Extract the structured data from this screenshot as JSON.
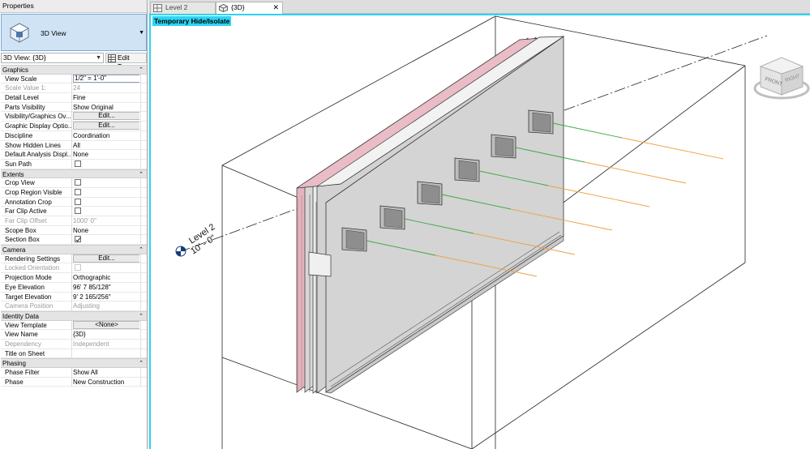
{
  "properties": {
    "title": "Properties",
    "type_name": "3D View",
    "instance_selector": "3D View: {3D}",
    "edit_type": "Edit Type",
    "sections": [
      {
        "name": "Graphics",
        "rows": [
          {
            "label": "View Scale",
            "value": "1/2\" = 1'-0\"",
            "kind": "input"
          },
          {
            "label": "Scale Value    1:",
            "value": "24",
            "kind": "text",
            "disabled": true
          },
          {
            "label": "Detail Level",
            "value": "Fine",
            "kind": "text"
          },
          {
            "label": "Parts Visibility",
            "value": "Show Original",
            "kind": "text"
          },
          {
            "label": "Visibility/Graphics Ov...",
            "value": "Edit...",
            "kind": "button"
          },
          {
            "label": "Graphic Display Optio...",
            "value": "Edit...",
            "kind": "button"
          },
          {
            "label": "Discipline",
            "value": "Coordination",
            "kind": "text"
          },
          {
            "label": "Show Hidden Lines",
            "value": "All",
            "kind": "text"
          },
          {
            "label": "Default Analysis Displ...",
            "value": "None",
            "kind": "text"
          },
          {
            "label": "Sun Path",
            "value": "",
            "kind": "check",
            "checked": false
          }
        ]
      },
      {
        "name": "Extents",
        "rows": [
          {
            "label": "Crop View",
            "value": "",
            "kind": "check",
            "checked": false
          },
          {
            "label": "Crop Region Visible",
            "value": "",
            "kind": "check",
            "checked": false
          },
          {
            "label": "Annotation Crop",
            "value": "",
            "kind": "check",
            "checked": false
          },
          {
            "label": "Far Clip Active",
            "value": "",
            "kind": "check",
            "checked": false
          },
          {
            "label": "Far Clip Offset",
            "value": "1000'  0\"",
            "kind": "text",
            "disabled": true
          },
          {
            "label": "Scope Box",
            "value": "None",
            "kind": "text"
          },
          {
            "label": "Section Box",
            "value": "",
            "kind": "check",
            "checked": true
          }
        ]
      },
      {
        "name": "Camera",
        "rows": [
          {
            "label": "Rendering Settings",
            "value": "Edit...",
            "kind": "button"
          },
          {
            "label": "Locked Orientation",
            "value": "",
            "kind": "check",
            "checked": false,
            "disabled": true
          },
          {
            "label": "Projection Mode",
            "value": "Orthographic",
            "kind": "text"
          },
          {
            "label": "Eye Elevation",
            "value": "96'  7 85/128\"",
            "kind": "text"
          },
          {
            "label": "Target Elevation",
            "value": "9'  2 165/256\"",
            "kind": "text"
          },
          {
            "label": "Camera Position",
            "value": "Adjusting",
            "kind": "text",
            "disabled": true
          }
        ]
      },
      {
        "name": "Identity Data",
        "rows": [
          {
            "label": "View Template",
            "value": "<None>",
            "kind": "button"
          },
          {
            "label": "View Name",
            "value": "{3D}",
            "kind": "text"
          },
          {
            "label": "Dependency",
            "value": "Independent",
            "kind": "text",
            "disabled": true
          },
          {
            "label": "Title on Sheet",
            "value": "",
            "kind": "text"
          }
        ]
      },
      {
        "name": "Phasing",
        "rows": [
          {
            "label": "Phase Filter",
            "value": "Show All",
            "kind": "text"
          },
          {
            "label": "Phase",
            "value": "New Construction",
            "kind": "text"
          }
        ]
      }
    ]
  },
  "tabs": [
    {
      "label": "Level 2",
      "icon": "floor-plan-icon",
      "active": false
    },
    {
      "label": "{3D}",
      "icon": "3d-view-icon",
      "active": true
    }
  ],
  "viewport": {
    "temp_mode_label": "Temporary Hide/Isolate",
    "level_name": "Level 2",
    "level_elevation": "10' - 0\"",
    "viewcube_face_front": "FRONT",
    "viewcube_face_right": "RIGHT"
  },
  "colors": {
    "accent_border": "#2bd4f2",
    "panel_selected": "#cfe3f5",
    "green_line": "#3aa845",
    "orange_line": "#f0a040",
    "wall_pink": "#e3b3be"
  }
}
